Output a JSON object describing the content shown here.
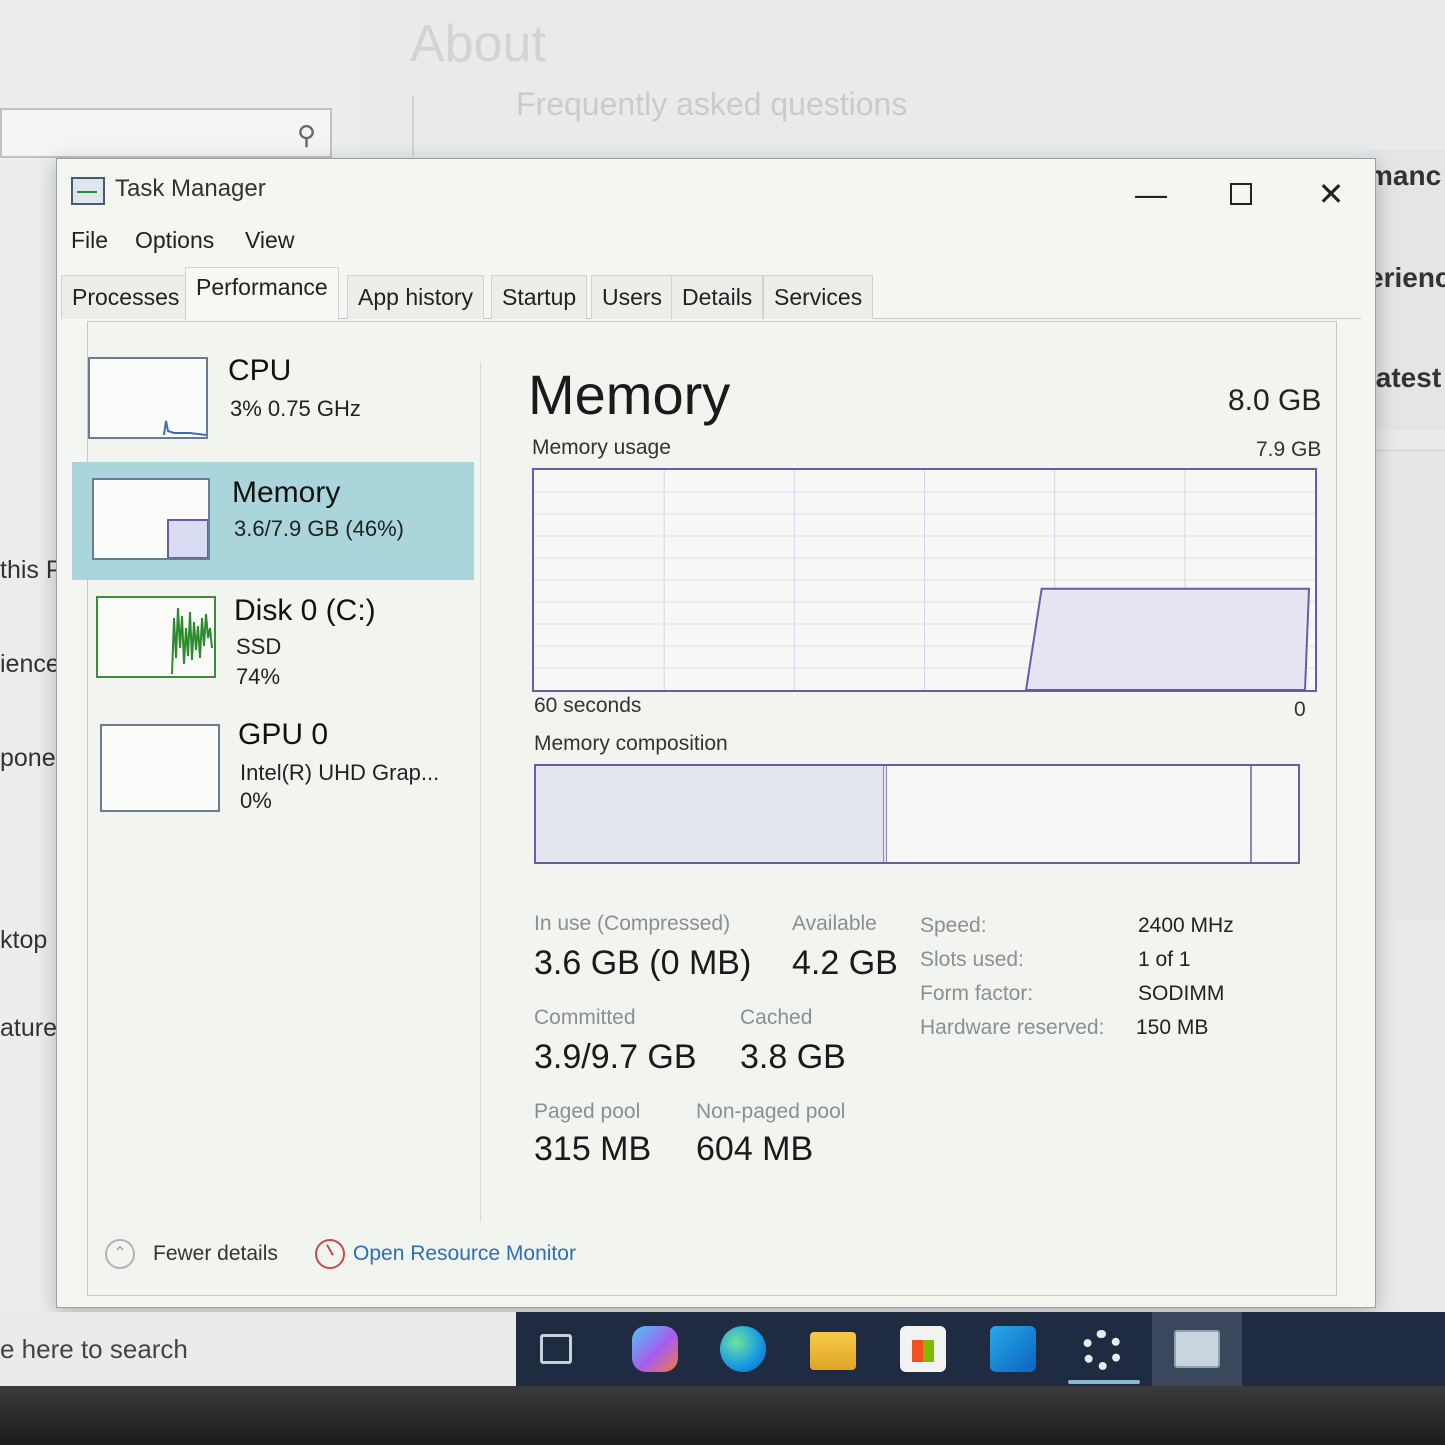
{
  "background": {
    "about_title": "About",
    "faq_heading": "Frequently asked questions",
    "edge_texts": [
      "manc",
      "erienc",
      "latest"
    ],
    "nav_fragments": [
      "this P",
      "iences",
      "ponen",
      "ktop",
      "atures"
    ]
  },
  "window": {
    "title": "Task Manager",
    "controls": {
      "minimize": "—",
      "close": "✕"
    }
  },
  "menu": [
    "File",
    "Options",
    "View"
  ],
  "tabs": [
    "Processes",
    "Performance",
    "App history",
    "Startup",
    "Users",
    "Details",
    "Services"
  ],
  "active_tab": "Performance",
  "sidebar": {
    "cpu": {
      "name": "CPU",
      "sub1": "3% 0.75 GHz"
    },
    "memory": {
      "name": "Memory",
      "sub1": "3.6/7.9 GB (46%)"
    },
    "disk": {
      "name": "Disk 0 (C:)",
      "sub1": "SSD",
      "sub2": "74%"
    },
    "gpu": {
      "name": "GPU 0",
      "sub1": "Intel(R) UHD Grap...",
      "sub2": "0%"
    }
  },
  "main": {
    "title": "Memory",
    "total": "8.0 GB",
    "usage_label": "Memory usage",
    "usage_max": "7.9 GB",
    "graph_time_label": "60 seconds",
    "graph_end_label": "0",
    "composition_label": "Memory composition",
    "usage_fraction": 0.46,
    "composition": {
      "in_use_fraction": 0.46,
      "standby_end_fraction": 0.94
    }
  },
  "stats": {
    "in_use_label": "In use (Compressed)",
    "in_use_value": "3.6 GB (0 MB)",
    "available_label": "Available",
    "available_value": "4.2 GB",
    "committed_label": "Committed",
    "committed_value": "3.9/9.7 GB",
    "cached_label": "Cached",
    "cached_value": "3.8 GB",
    "paged_label": "Paged pool",
    "paged_value": "315 MB",
    "nonpaged_label": "Non-paged pool",
    "nonpaged_value": "604 MB"
  },
  "specs": {
    "speed_key": "Speed:",
    "speed_val": "2400 MHz",
    "slots_key": "Slots used:",
    "slots_val": "1 of 1",
    "form_key": "Form factor:",
    "form_val": "SODIMM",
    "hw_key": "Hardware reserved:",
    "hw_val": "150 MB"
  },
  "footer": {
    "fewer_details": "Fewer details",
    "open_resource_monitor": "Open Resource Monitor"
  },
  "taskbar": {
    "search_placeholder": "e here to search"
  },
  "colors": {
    "selected_bg": "#a9d5db",
    "graph_border": "#6a5aa8",
    "link": "#2a6fb8",
    "disk_graph": "#2e8a2e"
  }
}
